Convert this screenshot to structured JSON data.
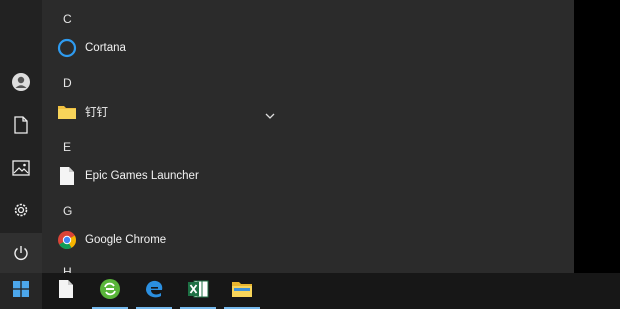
{
  "start_menu": {
    "sections": [
      {
        "letter": "C",
        "app": "Cortana",
        "icon": "cortana-icon"
      },
      {
        "letter": "D",
        "app": "钉钉",
        "icon": "folder-icon",
        "expandable": true
      },
      {
        "letter": "E",
        "app": "Epic Games Launcher",
        "icon": "file-icon"
      },
      {
        "letter": "G",
        "app": "Google Chrome",
        "icon": "chrome-icon"
      },
      {
        "letter": "H"
      }
    ],
    "rail": [
      "user-icon",
      "document-icon",
      "pictures-icon",
      "settings-icon",
      "power-icon"
    ]
  },
  "taskbar": {
    "items": [
      "windows-start-icon",
      "file-icon",
      "refresh-app-icon",
      "edge-icon",
      "excel-icon",
      "file-explorer-icon"
    ]
  },
  "colors": {
    "accent": "#76b9ed",
    "menu_bg": "#2b2b2b",
    "taskbar_bg": "#171717"
  }
}
